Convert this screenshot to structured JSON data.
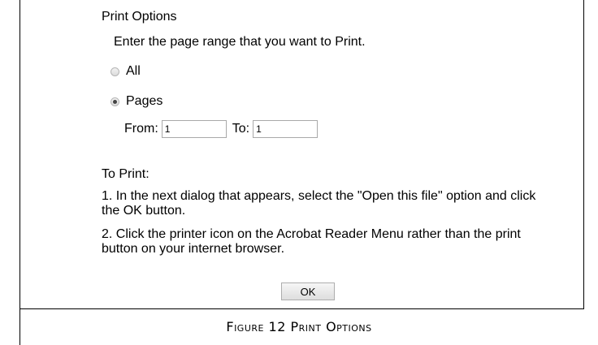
{
  "dialog": {
    "title": "Print Options",
    "instruction": "Enter the page range that you want to Print.",
    "options": [
      {
        "label": "All",
        "selected": false
      },
      {
        "label": "Pages",
        "selected": true
      }
    ],
    "range": {
      "from_label": "From:",
      "from_value": "1",
      "to_label": "To:",
      "to_value": "1"
    },
    "to_print_heading": "To Print:",
    "steps": [
      "1. In the next dialog that appears, select the \"Open this file\" option and click the OK button.",
      "2. Click the printer icon on the Acrobat Reader Menu rather than the print button on your internet browser."
    ],
    "ok_label": "OK"
  },
  "caption": "Figure 12 Print Options"
}
